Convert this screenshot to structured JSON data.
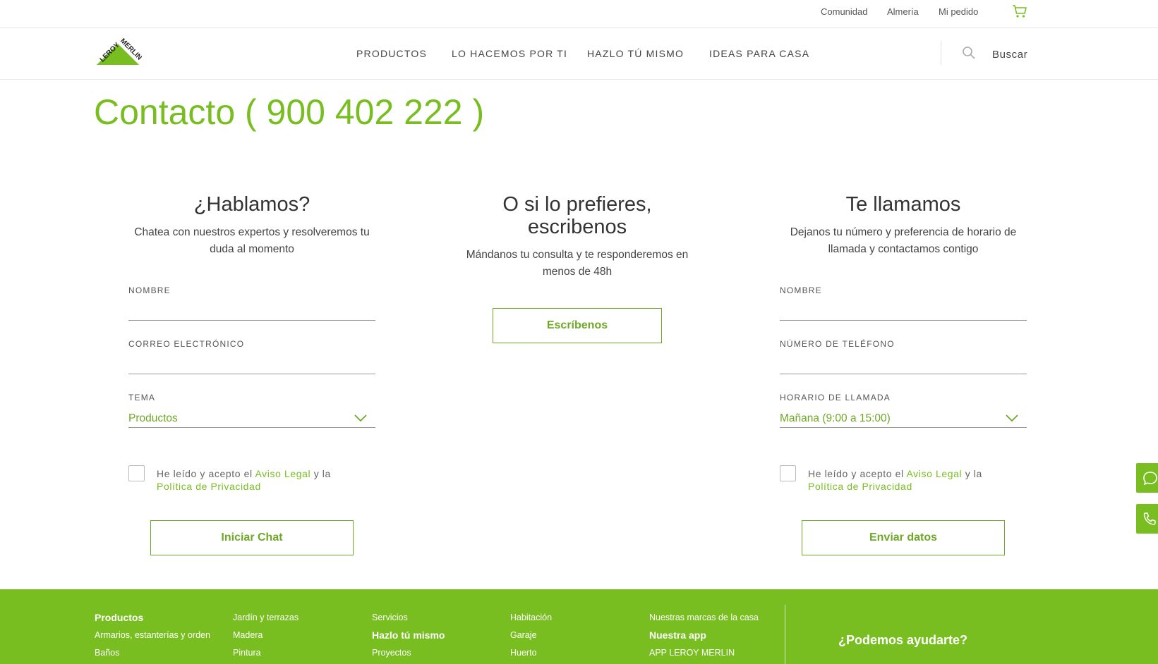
{
  "topbar": {
    "links": [
      "Comunidad",
      "Almería",
      "Mi pedido"
    ],
    "cart_icon": "cart-icon"
  },
  "nav": {
    "logo_text": "LEROY MERLIN",
    "items": [
      "PRODUCTOS",
      "LO HACEMOS POR TI",
      "HAZLO TÚ MISMO",
      "IDEAS PARA CASA"
    ],
    "search_label": "Buscar"
  },
  "page": {
    "title": "Contacto ( 900 402 222 )"
  },
  "chat": {
    "heading": "¿Hablamos?",
    "description": "Chatea con nuestros expertos y resolveremos tu duda al momento",
    "name_label": "NOMBRE",
    "email_label": "CORREO ELECTRÓNICO",
    "topic_label": "TEMA",
    "topic_value": "Productos",
    "consent_prefix": "He leído y acepto el ",
    "consent_legal": "Aviso Legal",
    "consent_mid": " y la ",
    "consent_privacy": "Política de Privacidad",
    "button": "Iniciar Chat"
  },
  "write": {
    "heading_line1": "O si lo prefieres,",
    "heading_line2": "escribenos",
    "description": "Mándanos tu consulta y te responderemos en menos de 48h",
    "button": "Escríbenos"
  },
  "callback": {
    "heading": "Te llamamos",
    "description": "Dejanos tu número y preferencia de horario de llamada y contactamos contigo",
    "name_label": "NOMBRE",
    "phone_label": "NÚMERO DE TELÉFONO",
    "schedule_label": "HORARIO DE LLAMADA",
    "schedule_value": "Mañana (9:00 a 15:00)",
    "consent_prefix": "He leído y acepto el ",
    "consent_legal": "Aviso Legal",
    "consent_mid": " y la ",
    "consent_privacy": "Política de Privacidad",
    "button": "Enviar datos"
  },
  "footer": {
    "col1": [
      "Productos",
      "Armarios, estanterías y orden",
      "Baños"
    ],
    "col2": [
      "Jardín y terrazas",
      "Madera",
      "Pintura"
    ],
    "col3": [
      "Servicios",
      "Hazlo tú mismo",
      "Proyectos"
    ],
    "col4": [
      "Habitación",
      "Garaje",
      "Huerto"
    ],
    "col5": [
      "Nuestras marcas de la casa",
      "Nuestra app",
      "APP LEROY MERLIN"
    ],
    "help": "¿Podemos ayudarte?"
  },
  "colors": {
    "brand_green": "#78be20",
    "text": "#333333"
  }
}
